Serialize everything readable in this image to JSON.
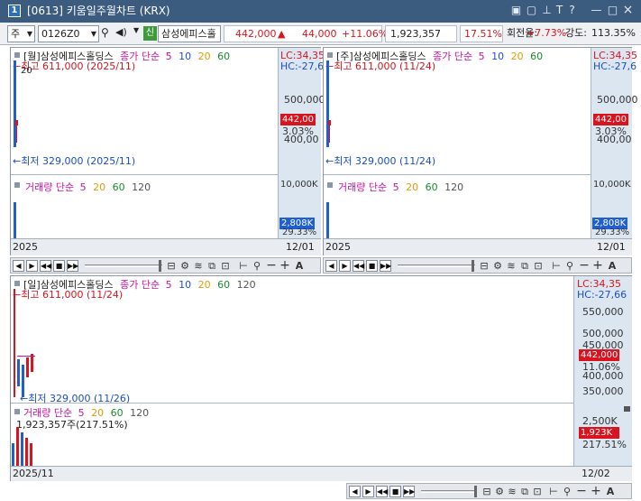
{
  "window": {
    "number": "1",
    "title": "[0613] 키움일주월차트 (KRX)",
    "controls": [
      "▣",
      "▢",
      "⊥",
      "T",
      "?",
      "—",
      "□",
      "×"
    ]
  },
  "toolbar": {
    "market": "주",
    "code": "0126Z0",
    "name_badge": "신",
    "name": "삼성에피스홀",
    "price": "442,000",
    "change_arrow": "▲",
    "change": "44,000",
    "change_pct": "+11.06%",
    "volume": "1,923,357",
    "vol_pct": "17.51%",
    "turnover_label": "회전율:",
    "turnover": "+7.73%",
    "strength_label": "강도:",
    "strength": "113.35%"
  },
  "pane_week_left": {
    "legend_title": "[월]삼성에피스홀딩스",
    "legend_ma_label": "종가 단순",
    "legend_periods": [
      "5",
      "10",
      "20",
      "60"
    ],
    "high": "←최고 611,000 (2025/11)",
    "high_val": "20",
    "low": "←최저 329,000 (2025/11)",
    "axis_lc": "LC:34,35",
    "axis_hc": "HC:-27,6",
    "ticks": [
      "500,000",
      "442,00",
      "3.03%",
      "400,00"
    ],
    "vol_legend": "거래량  단순",
    "vol_periods": [
      "5",
      "20",
      "60",
      "120"
    ],
    "vol_ticks": [
      "10,000K",
      "2,808K",
      "29.33%"
    ],
    "date_left": "2025",
    "date_right": "12/01"
  },
  "pane_week_right": {
    "legend_title": "[주]삼성에피스홀딩스",
    "legend_ma_label": "종가 단순",
    "legend_periods": [
      "5",
      "10",
      "20",
      "60"
    ],
    "high": "←최고 611,000 (11/24)",
    "low": "←최저 329,000 (11/24)",
    "axis_lc": "LC:34,35",
    "axis_hc": "HC:-27,6",
    "ticks": [
      "500,000",
      "442,00",
      "3.03%",
      "400,00"
    ],
    "vol_legend": "거래량  단순",
    "vol_periods": [
      "5",
      "20",
      "60",
      "120"
    ],
    "vol_ticks": [
      "10,000K",
      "2,808K",
      "29.33%"
    ],
    "date_left": "2025",
    "date_right": "12/01"
  },
  "pane_day": {
    "legend_title": "[일]삼성에피스홀딩스",
    "legend_ma_label": "종가 단순",
    "legend_periods": [
      "5",
      "10",
      "20",
      "60",
      "120"
    ],
    "high": "←최고 611,000 (11/24)",
    "low": "←최저 329,000 (11/26)",
    "axis_lc": "LC:34,35",
    "axis_hc": "HC:-27,66",
    "ticks": [
      "550,000",
      "500,000",
      "450,000",
      "442,000",
      "11.06%",
      "400,000",
      "350,000"
    ],
    "vol_legend": "거래량  단순",
    "vol_periods": [
      "5",
      "20",
      "60",
      "120"
    ],
    "vol_note": "1,923,357주(217.51%)",
    "vol_ticks": [
      "2,500K",
      "1,923K",
      "217.51%"
    ],
    "date_left": "2025/11",
    "date_right": "12/02"
  },
  "colors": {
    "up": "#d8141e",
    "down": "#1c4fbf",
    "ma5": "#c8139b",
    "ma10": "#1f4fd8",
    "ma20": "#e39b00",
    "ma60": "#1b8a2d",
    "ma120": "#555555"
  }
}
